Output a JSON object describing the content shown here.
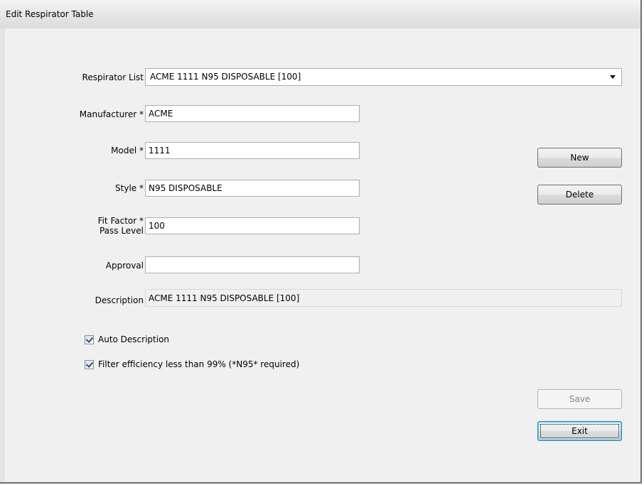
{
  "window": {
    "title": "Edit Respirator Table"
  },
  "form": {
    "respirator_list": {
      "label": "Respirator List",
      "value": "ACME 1111 N95 DISPOSABLE [100]"
    },
    "manufacturer": {
      "label": "Manufacturer *",
      "value": "ACME"
    },
    "model": {
      "label": "Model *",
      "value": "1111"
    },
    "style": {
      "label": "Style *",
      "value": "N95 DISPOSABLE"
    },
    "fit_factor": {
      "label_line1": "Fit Factor *",
      "label_line2": "Pass Level",
      "value": "100"
    },
    "approval": {
      "label": "Approval",
      "value": ""
    },
    "description": {
      "label": "Description",
      "value": "ACME 1111 N95 DISPOSABLE [100]"
    },
    "auto_description": {
      "label": "Auto Description",
      "checked": true
    },
    "filter_efficiency": {
      "label": "Filter efficiency less than 99% (*N95* required)",
      "checked": true
    }
  },
  "buttons": {
    "new": "New",
    "delete": "Delete",
    "save": "Save",
    "exit": "Exit"
  }
}
